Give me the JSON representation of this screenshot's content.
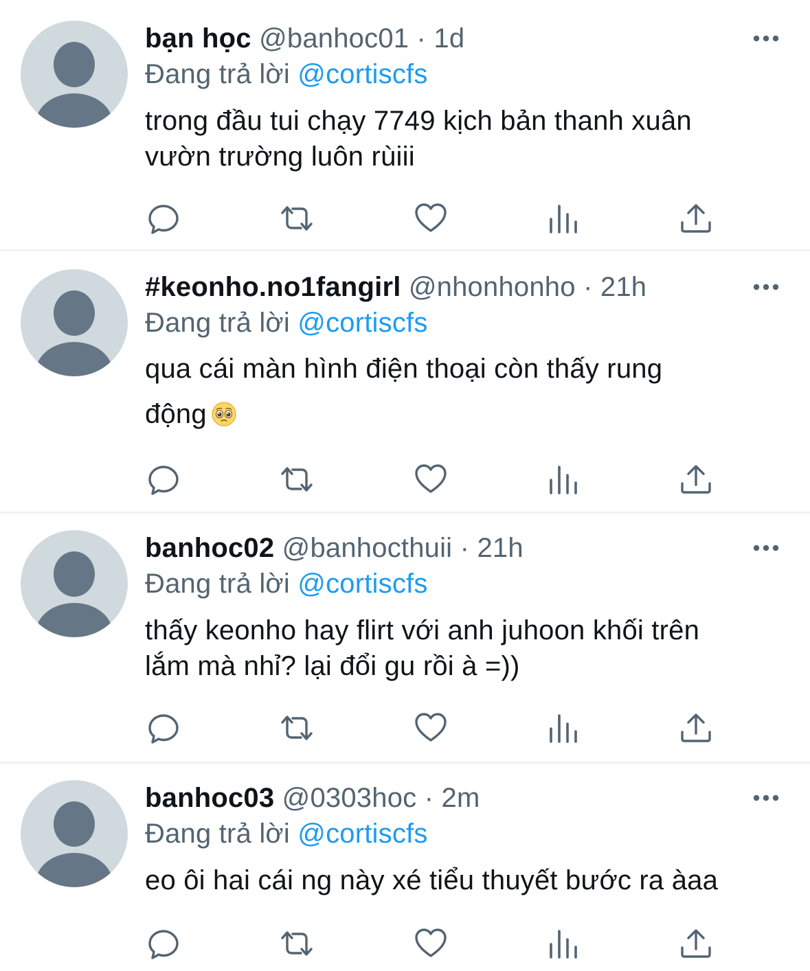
{
  "tweets": [
    {
      "display_name": "bạn học",
      "handle": "@banhoc01",
      "separator": "·",
      "time": "1d",
      "reply_prefix": "Đang trả lời",
      "reply_to": "@cortiscfs",
      "text_lines": [
        "trong đầu tui chạy 7749 kịch bản thanh xuân",
        "vườn trường luôn rùiii"
      ]
    },
    {
      "display_name": "#keonho.no1fangirl",
      "handle": "@nhonhonho",
      "separator": "·",
      "time": "21h",
      "reply_prefix": "Đang trả lời",
      "reply_to": "@cortiscfs",
      "text_lines": [
        "qua cái màn hình điện thoại còn thấy rung",
        "động"
      ],
      "emoji": "pleading-face-emoji"
    },
    {
      "display_name": "banhoc02",
      "handle": "@banhocthuii",
      "separator": "·",
      "time": "21h",
      "reply_prefix": "Đang trả lời",
      "reply_to": "@cortiscfs",
      "text_lines": [
        "thấy keonho hay flirt với anh juhoon khối trên",
        "lắm mà nhỉ? lại đổi gu rồi à =))"
      ]
    },
    {
      "display_name": "banhoc03",
      "handle": "@0303hoc",
      "separator": "·",
      "time": "2m",
      "reply_prefix": "Đang trả lời",
      "reply_to": "@cortiscfs",
      "text_lines": [
        "eo ôi hai cái ng này xé tiểu thuyết bước ra àaa"
      ]
    }
  ],
  "icons": {
    "avatar": "default-avatar-icon",
    "more": "more-options-icon",
    "reply": "reply-icon",
    "retweet": "retweet-icon",
    "like": "heart-icon",
    "views": "views-icon",
    "share": "share-icon"
  },
  "colors": {
    "text": "#0f1419",
    "secondary": "#536471",
    "link": "#1d9bf0",
    "avatar_bg": "#cfd9de",
    "avatar_fg": "#657786",
    "divider": "#eff3f4"
  }
}
